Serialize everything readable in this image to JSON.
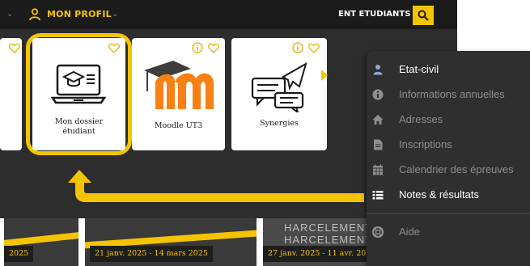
{
  "topbar": {
    "profile_label": "MON PROFIL",
    "ent_label": "ENT ETUDIANTS"
  },
  "tiles": [
    {
      "label": "Mon dossier étudiant",
      "icon": "laptop-graduation-icon"
    },
    {
      "label": "Moodle UT3",
      "icon": "moodle-logo-icon"
    },
    {
      "label": "Synergies",
      "icon": "chat-paper-plane-icon"
    }
  ],
  "thumbnails": [
    {
      "date": "2025"
    },
    {
      "date": "21 janv. 2025 - 14 mars 2025"
    },
    {
      "date": "27 janv. 2025 - 11 avr. 2025",
      "overlay": "HARCELEMENT"
    }
  ],
  "menu": {
    "items": [
      {
        "label": "Etat-civil",
        "icon": "user-icon",
        "state": "active"
      },
      {
        "label": "Informations annuelles",
        "icon": "info-icon",
        "state": "muted"
      },
      {
        "label": "Adresses",
        "icon": "home-icon",
        "state": "muted"
      },
      {
        "label": "Inscriptions",
        "icon": "file-icon",
        "state": "muted"
      },
      {
        "label": "Calendrier des épreuves",
        "icon": "calendar-icon",
        "state": "muted"
      },
      {
        "label": "Notes & résultats",
        "icon": "list-icon",
        "state": "active"
      },
      {
        "label": "Aide",
        "icon": "lifebuoy-icon",
        "state": "muted"
      }
    ]
  },
  "colors": {
    "accent": "#f5c400",
    "topbar_bg": "#1b1b1b",
    "panel_bg": "#2d2d2d",
    "menu_bg": "#2f2f2f",
    "moodle_orange": "#f98012"
  }
}
